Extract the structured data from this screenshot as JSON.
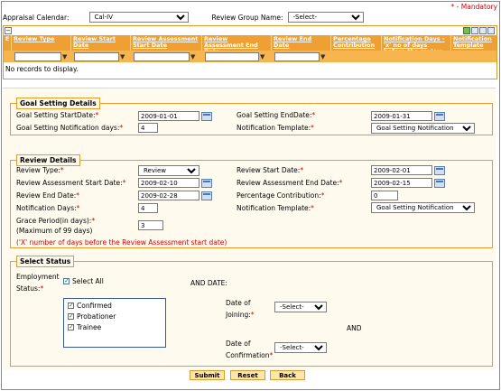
{
  "mandatory_note": "* - Mandatory",
  "filters": {
    "appraisal_calendar_label": "Appraisal Calendar:",
    "appraisal_calendar_value": "Cal-IV",
    "review_group_label": "Review Group Name:",
    "review_group_value": "-Select-"
  },
  "grid": {
    "columns": [
      "Review Type",
      "Review Start Date",
      "Review Assessment Start Date",
      "Review Assessment End Date",
      "Review End Date",
      "Percentage Contribution",
      "Notification Days - 'x' no of days before the review",
      "Notification Template"
    ],
    "empty_text": "No records to display."
  },
  "goal_setting": {
    "title": "Goal Setting Details",
    "start_label": "Goal Setting StartDate:",
    "start_value": "2009-01-01",
    "end_label": "Goal Setting EndDate:",
    "end_value": "2009-01-31",
    "notif_days_label": "Goal Setting Notification days:",
    "notif_days_value": "4",
    "template_label": "Notification Template:",
    "template_value": "Goal Setting Notification"
  },
  "review": {
    "title": "Review Details",
    "type_label": "Review Type:",
    "type_value": "Review",
    "start_label": "Review Start Date:",
    "start_value": "2009-02-01",
    "assess_start_label": "Review Assessment Start Date:",
    "assess_start_value": "2009-02-10",
    "assess_end_label": "Review Assessment End Date:",
    "assess_end_value": "2009-02-15",
    "end_label": "Review End Date:",
    "end_value": "2009-02-28",
    "pct_label": "Percentage Contribution:",
    "pct_value": "0",
    "notif_days_label": "Notification Days:",
    "notif_days_value": "4",
    "template_label": "Notification Template:",
    "template_value": "Goal Setting Notification",
    "grace_label": "Grace Period(in days):",
    "grace_value": "3",
    "grace_max": "(Maximum of 99 days)",
    "note": "('X' number of days before the Review Assessment start date)"
  },
  "select_status": {
    "title": "Select Status",
    "employment_label_1": "Employment",
    "employment_label_2": "Status:",
    "select_all": "Select All",
    "options": [
      "Confirmed",
      "Probationer",
      "Trainee"
    ],
    "and_date": "AND DATE:",
    "joining_label_1": "Date of",
    "joining_label_2": "Joining:",
    "joining_value": "-Select-",
    "and": "AND",
    "confirm_label_1": "Date of",
    "confirm_label_2": "Confirmation",
    "confirm_value": "-Select-"
  },
  "buttons": {
    "submit": "Submit",
    "reset": "Reset",
    "back": "Back"
  }
}
